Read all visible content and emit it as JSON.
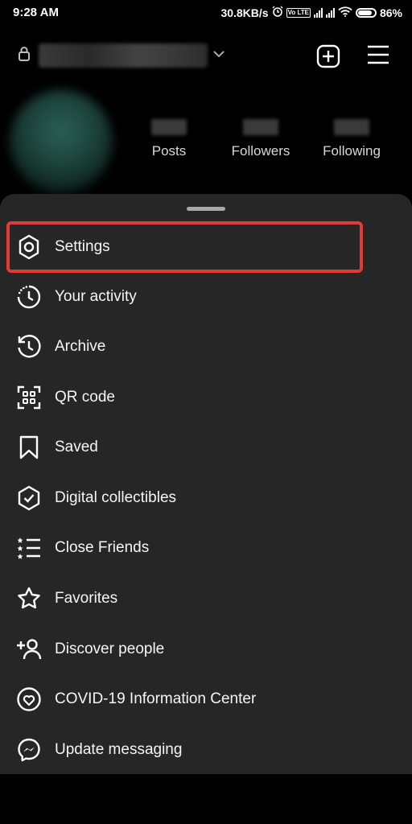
{
  "status_bar": {
    "time": "9:28 AM",
    "speed": "30.8KB/s",
    "volte": "Vo LTE",
    "battery": "86%",
    "battery_level": 0.86
  },
  "profile": {
    "stats": [
      {
        "label": "Posts"
      },
      {
        "label": "Followers"
      },
      {
        "label": "Following"
      }
    ]
  },
  "menu": {
    "items": [
      {
        "icon": "settings-icon",
        "label": "Settings"
      },
      {
        "icon": "activity-icon",
        "label": "Your activity"
      },
      {
        "icon": "archive-icon",
        "label": "Archive"
      },
      {
        "icon": "qr-code-icon",
        "label": "QR code"
      },
      {
        "icon": "bookmark-icon",
        "label": "Saved"
      },
      {
        "icon": "shield-check-icon",
        "label": "Digital collectibles"
      },
      {
        "icon": "star-list-icon",
        "label": "Close Friends"
      },
      {
        "icon": "star-icon",
        "label": "Favorites"
      },
      {
        "icon": "add-person-icon",
        "label": "Discover people"
      },
      {
        "icon": "heart-circle-icon",
        "label": "COVID-19 Information Center"
      },
      {
        "icon": "messenger-icon",
        "label": "Update messaging"
      }
    ]
  },
  "colors": {
    "sheet_bg": "#262626",
    "highlight": "#e53935",
    "background": "#000000"
  }
}
